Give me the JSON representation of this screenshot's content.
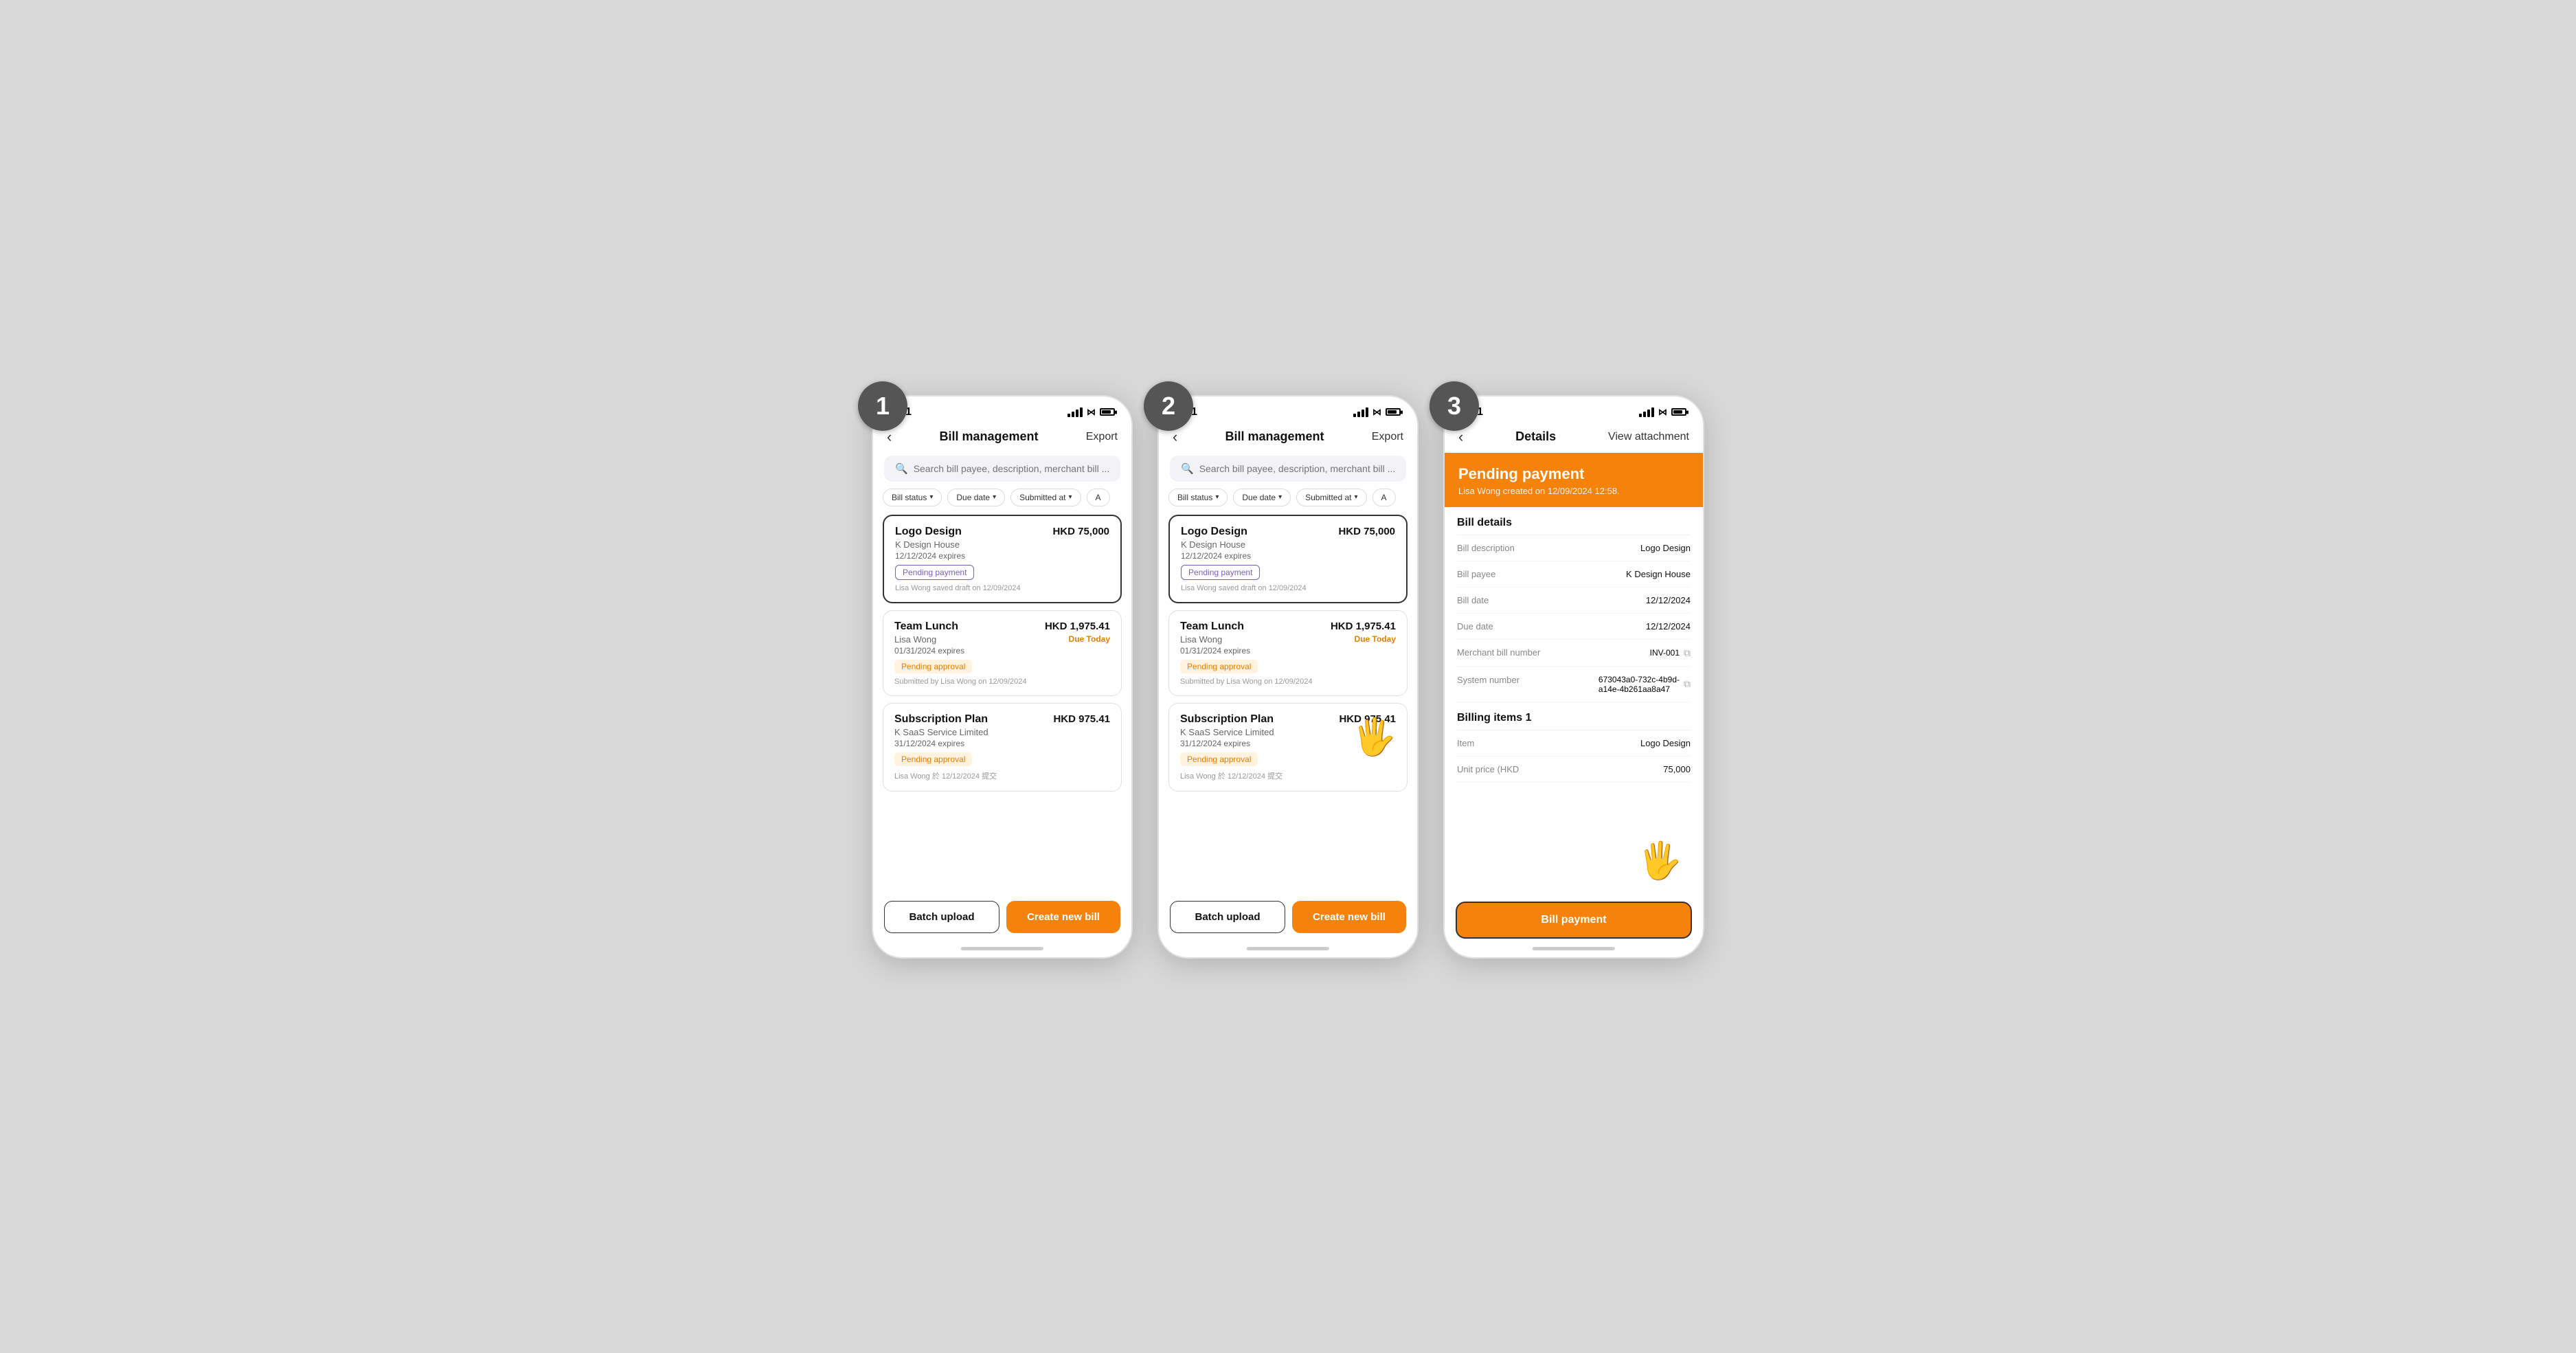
{
  "steps": [
    {
      "number": "1",
      "statusBar": {
        "time": "9:41"
      },
      "nav": {
        "back": "‹",
        "title": "Bill management",
        "action": "Export"
      },
      "search": {
        "placeholder": "Search bill payee, description, merchant bill ...."
      },
      "filters": [
        {
          "label": "Bill status",
          "arrow": "▾"
        },
        {
          "label": "Due date",
          "arrow": "▾"
        },
        {
          "label": "Submitted at",
          "arrow": "▾"
        },
        {
          "label": "A",
          "arrow": ""
        }
      ],
      "bills": [
        {
          "name": "Logo Design",
          "amount": "HKD 75,000",
          "payee": "K Design House",
          "date": "12/12/2024 expires",
          "badge": "pending-payment",
          "badgeLabel": "Pending payment",
          "footer": "Lisa Wong saved draft on 12/09/2024",
          "selected": true,
          "dueToday": ""
        },
        {
          "name": "Team Lunch",
          "amount": "HKD 1,975.41",
          "payee": "Lisa Wong",
          "date": "01/31/2024 expires",
          "badge": "pending-approval",
          "badgeLabel": "Pending approval",
          "footer": "Submitted by Lisa Wong on 12/09/2024",
          "selected": false,
          "dueToday": "Due Today"
        },
        {
          "name": "Subscription Plan",
          "amount": "HKD 975.41",
          "payee": "K SaaS Service Limited",
          "date": "31/12/2024 expires",
          "badge": "pending-approval",
          "badgeLabel": "Pending approval",
          "footer": "Lisa Wong 於 12/12/2024 提交",
          "selected": false,
          "dueToday": ""
        }
      ],
      "buttons": {
        "batch": "Batch upload",
        "create": "Create new bill"
      }
    },
    {
      "number": "2",
      "statusBar": {
        "time": "9:41"
      },
      "nav": {
        "back": "‹",
        "title": "Bill management",
        "action": "Export"
      },
      "search": {
        "placeholder": "Search bill payee, description, merchant bill ...."
      },
      "filters": [
        {
          "label": "Bill status",
          "arrow": "▾"
        },
        {
          "label": "Due date",
          "arrow": "▾"
        },
        {
          "label": "Submitted at",
          "arrow": "▾"
        },
        {
          "label": "A",
          "arrow": ""
        }
      ],
      "bills": [
        {
          "name": "Logo Design",
          "amount": "HKD 75,000",
          "payee": "K Design House",
          "date": "12/12/2024 expires",
          "badge": "pending-payment",
          "badgeLabel": "Pending payment",
          "footer": "Lisa Wong saved draft on 12/09/2024",
          "selected": true,
          "dueToday": ""
        },
        {
          "name": "Team Lunch",
          "amount": "HKD 1,975.41",
          "payee": "Lisa Wong",
          "date": "01/31/2024 expires",
          "badge": "pending-approval",
          "badgeLabel": "Pending approval",
          "footer": "Submitted by Lisa Wong on 12/09/2024",
          "selected": false,
          "dueToday": "Due Today"
        },
        {
          "name": "Subscription Plan",
          "amount": "HKD 975.41",
          "payee": "K SaaS Service Limited",
          "date": "31/12/2024 expires",
          "badge": "pending-approval",
          "badgeLabel": "Pending approval",
          "footer": "Lisa Wong 於 12/12/2024 提交",
          "selected": false,
          "dueToday": ""
        }
      ],
      "buttons": {
        "batch": "Batch upload",
        "create": "Create new bill"
      },
      "showCursor": true
    },
    {
      "number": "3",
      "statusBar": {
        "time": "9:41"
      },
      "nav": {
        "back": "‹",
        "title": "Details",
        "action": "View attachment"
      },
      "pendingBanner": {
        "title": "Pending payment",
        "sub": "Lisa Wong created on 12/09/2024 12:58."
      },
      "billDetails": {
        "sectionTitle": "Bill details",
        "rows": [
          {
            "label": "Bill description",
            "value": "Logo Design",
            "copy": false
          },
          {
            "label": "Bill payee",
            "value": "K Design House",
            "copy": false
          },
          {
            "label": "Bill date",
            "value": "12/12/2024",
            "copy": false
          },
          {
            "label": "Due date",
            "value": "12/12/2024",
            "copy": false
          },
          {
            "label": "Merchant bill number",
            "value": "INV-001",
            "copy": true
          },
          {
            "label": "System number",
            "value": "673043a0-732c-4b9d-\na14e-4b261aa8a47",
            "copy": true
          }
        ]
      },
      "billingItems": {
        "sectionTitle": "Billing items 1",
        "rows": [
          {
            "label": "Item",
            "value": "Logo Design",
            "copy": false
          },
          {
            "label": "Unit price (HKD",
            "value": "75,000",
            "copy": false
          }
        ]
      },
      "payButton": "Bill payment",
      "showCursor": true
    }
  ]
}
